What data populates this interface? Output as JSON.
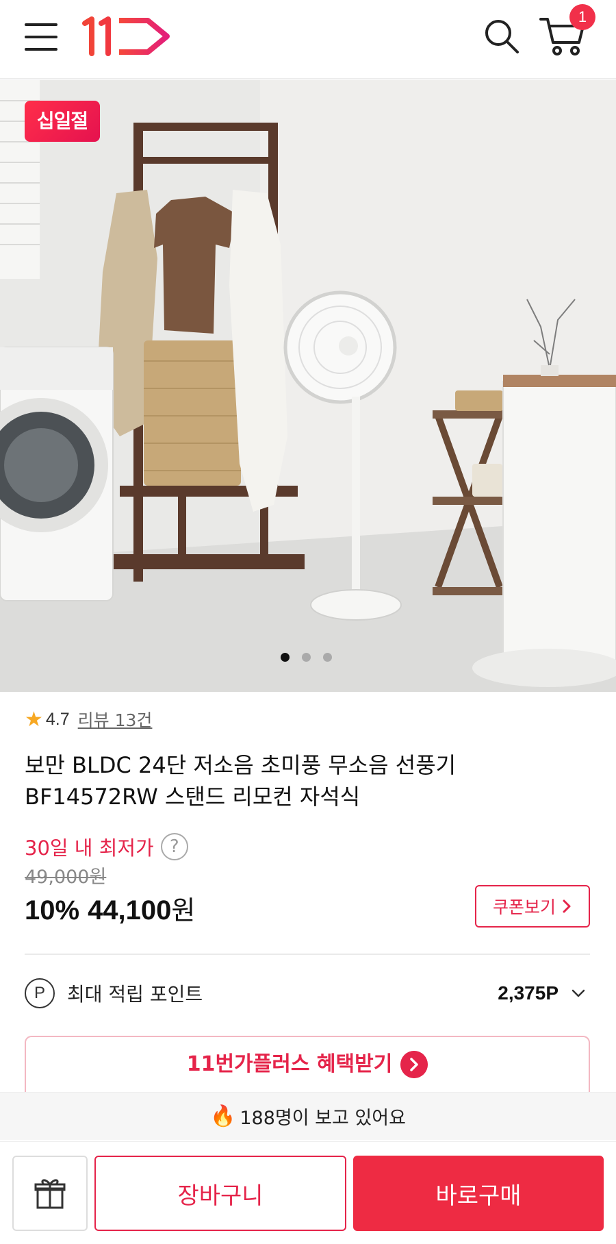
{
  "header": {
    "cart_count": "1"
  },
  "hero": {
    "promo_badge": "십일절",
    "slide_count": 3,
    "active_slide": 1
  },
  "product": {
    "rating": "4.7",
    "review_link": "리뷰 13건",
    "title": "보만 BLDC 24단 저소음 초미풍 무소음 선풍기 BF14572RW 스탠드 리모컨 자석식",
    "lowest_label": "30일 내 최저가",
    "help_icon": "?",
    "original_price": "49,000원",
    "discount": "10%",
    "sale_price": "44,100",
    "sale_unit": "원",
    "coupon_button": "쿠폰보기"
  },
  "points": {
    "icon_letter": "P",
    "label": "최대 적립 포인트",
    "value": "2,375P"
  },
  "plus_banner": {
    "text": "11번가플러스 혜택받기"
  },
  "viewers": {
    "text": "188명이 보고 있어요"
  },
  "bottom_bar": {
    "cart_button": "장바구니",
    "buy_button": "바로구매"
  },
  "colors": {
    "brand_red": "#e5244a",
    "buy_button": "#ee2b43",
    "star": "#f7a823"
  },
  "icons": [
    "menu-icon",
    "search-icon",
    "cart-icon",
    "question-icon",
    "chevron-right-icon",
    "points-icon",
    "chevron-down-icon",
    "fire-icon",
    "gift-icon"
  ]
}
